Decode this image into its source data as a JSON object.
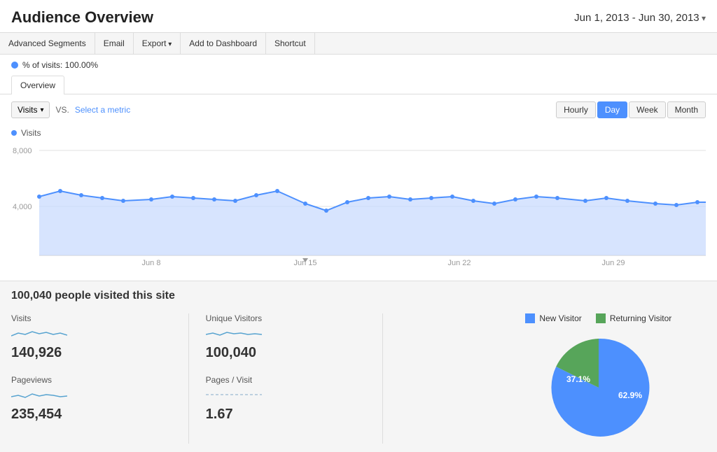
{
  "header": {
    "title": "Audience Overview",
    "date_range": "Jun 1, 2013 - Jun 30, 2013"
  },
  "toolbar": {
    "buttons": [
      {
        "label": "Advanced Segments",
        "has_arrow": false
      },
      {
        "label": "Email",
        "has_arrow": false
      },
      {
        "label": "Export",
        "has_arrow": true
      },
      {
        "label": "Add to Dashboard",
        "has_arrow": false
      },
      {
        "label": "Shortcut",
        "has_arrow": false
      }
    ]
  },
  "visits_filter": {
    "label": "% of visits: 100.00%"
  },
  "tabs": [
    {
      "label": "Overview",
      "active": true
    }
  ],
  "chart_controls": {
    "metric": "Visits",
    "vs_label": "VS.",
    "select_metric": "Select a metric",
    "time_buttons": [
      {
        "label": "Hourly",
        "active": false
      },
      {
        "label": "Day",
        "active": true
      },
      {
        "label": "Week",
        "active": false
      },
      {
        "label": "Month",
        "active": false
      }
    ]
  },
  "chart": {
    "legend_label": "Visits",
    "y_labels": [
      "8,000",
      "4,000"
    ],
    "x_labels": [
      "Jun 8",
      "Jun 15",
      "Jun 22",
      "Jun 29"
    ],
    "color": "#4d90fe",
    "fill_color": "#c6d9fd"
  },
  "stats": {
    "title": "100,040 people visited this site",
    "metrics": [
      {
        "label": "Visits",
        "value": "140,926"
      },
      {
        "label": "Unique Visitors",
        "value": "100,040"
      },
      {
        "label": "Pageviews",
        "value": "235,454"
      },
      {
        "label": "Pages / Visit",
        "value": "1.67"
      }
    ],
    "pie": {
      "legend": [
        {
          "label": "New Visitor",
          "color": "#4d90fe"
        },
        {
          "label": "Returning Visitor",
          "color": "#57a55a"
        }
      ],
      "segments": [
        {
          "label": "62.9%",
          "value": 62.9,
          "color": "#4d90fe"
        },
        {
          "label": "37.1%",
          "value": 37.1,
          "color": "#57a55a"
        }
      ]
    }
  }
}
